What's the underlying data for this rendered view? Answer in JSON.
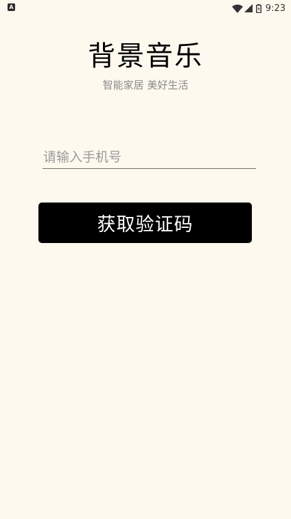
{
  "status_bar": {
    "notification_icon": "A",
    "time": "9:23",
    "icons": [
      "wifi-icon",
      "signal-icon",
      "battery-icon"
    ]
  },
  "header": {
    "title": "背景音乐",
    "subtitle": "智能家居 美好生活"
  },
  "form": {
    "phone_value": "",
    "phone_placeholder": "请输入手机号",
    "submit_label": "获取验证码"
  },
  "colors": {
    "background": "#FEF9EF",
    "button_background": "#000000",
    "button_text": "#FFFFFF",
    "subtitle_text": "#8A8A8A",
    "placeholder_text": "#9A9A9A"
  }
}
